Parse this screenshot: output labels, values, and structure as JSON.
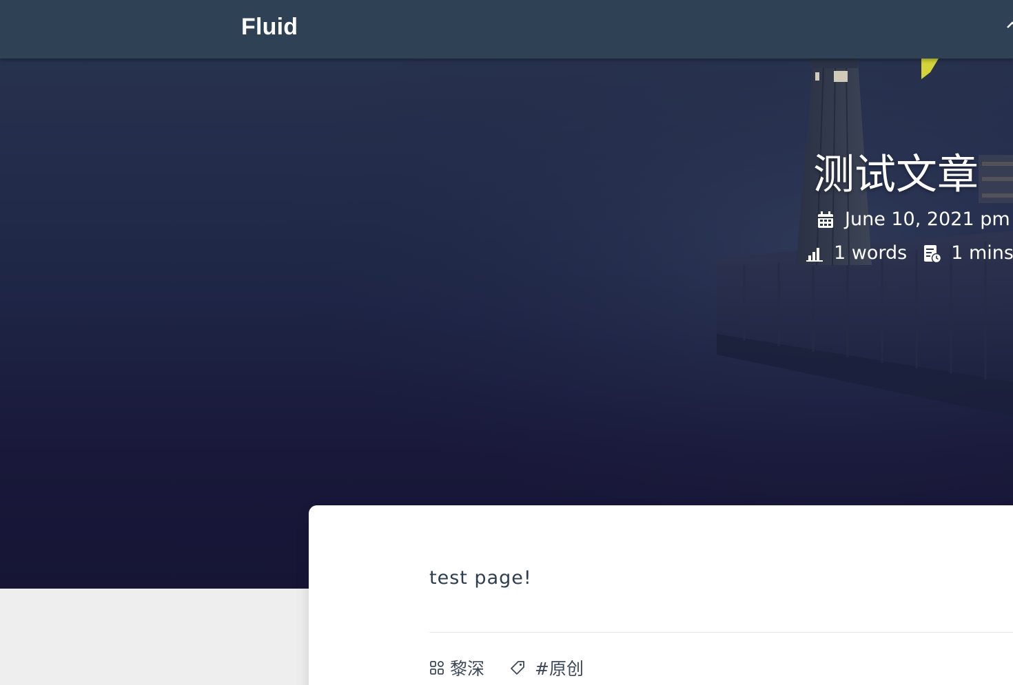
{
  "navbar": {
    "brand": "Fluid",
    "home_icon": "home-icon"
  },
  "post": {
    "title": "测试文章",
    "date": "June 10, 2021 pm",
    "words": "1 words",
    "read_time": "1 mins",
    "content": "test page!",
    "category": "黎深",
    "tag": "#原创"
  },
  "icons": {
    "date": "calendar-icon",
    "words": "bar-chart-icon",
    "read_time": "reading-time-icon",
    "category": "category-icon",
    "tag": "tag-icon"
  },
  "colors": {
    "navbar_bg": "#2f4154",
    "hero_top": "#27324e",
    "hero_bottom": "#161536",
    "page_bg": "#eeeeee",
    "card_bg": "#ffffff",
    "text": "#2c3e50"
  }
}
